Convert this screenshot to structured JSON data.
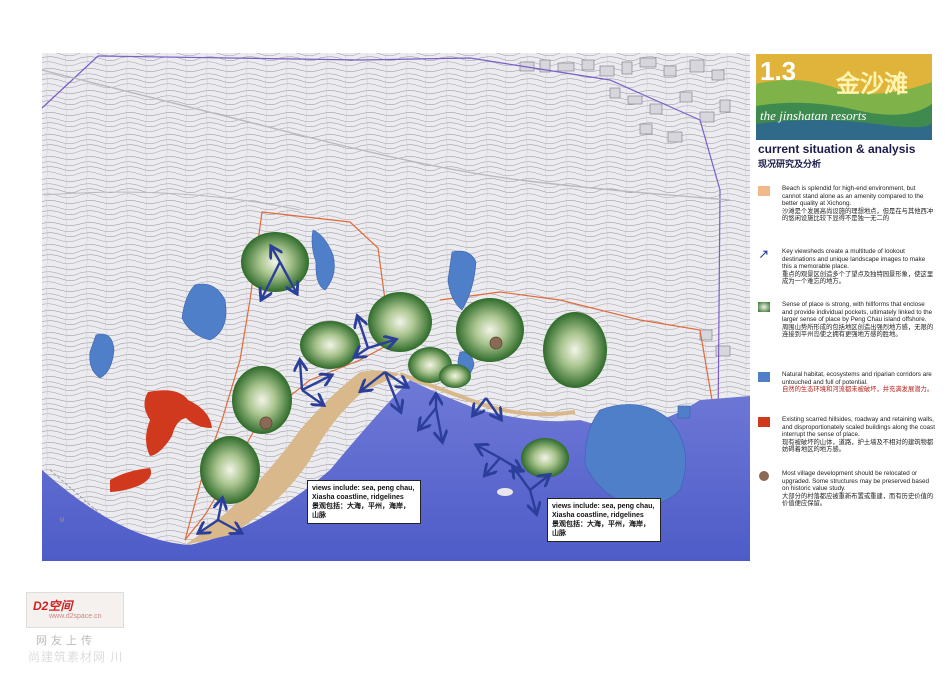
{
  "logo": {
    "number": "1.3",
    "chinese": "金沙滩",
    "english": "the jinshatan resorts"
  },
  "panel": {
    "title": "current situation & analysis",
    "subtitle": "现况研究及分析"
  },
  "legend": [
    {
      "symbol": "beach-swatch",
      "color": "#f1b98a",
      "en": "Beach is splendid for high-end environment, but cannot stand alone as an amenity compared to the better quality at Xichong.",
      "zh": "沙滩是个发展高尚设施的理想地点，但是在与其他西冲的悠闲设施比较下显得不是独一无二的"
    },
    {
      "symbol": "viewshed-arrow",
      "color": "#2b3e9a",
      "en": "Key viewsheds create a multitude of lookout destinations and unique landscape images to make this a memorable place.",
      "zh": "重点的观景区创造多个了望点及独特园景形象，使这里成为一个难忘的地方。"
    },
    {
      "symbol": "hillform-swatch",
      "color": "#2e6b2a",
      "en": "Sense of place is strong, with hillforms that enclose and provide individual pockets, ultimately linked to the larger sense of place by Peng Chau island offshore.",
      "zh": "周围山势所形成的包括地区创造出强烈地方感，无限的连接到平州岛使之拥有更强地方感的胜地。"
    },
    {
      "symbol": "habitat-swatch",
      "color": "#4f7fc8",
      "en": "Natural habitat, ecosystems and riparian corridors are untouched and full of potential.",
      "zh": "自然的生态环境和河流都未被破坏，并充满发展潜力。"
    },
    {
      "symbol": "scarred-swatch",
      "color": "#d0391e",
      "en": "Existing scarred hillsides, roadway and retaining walls, and disproportionately scaled buildings along the coast interrupt the sense of place.",
      "zh": "现有被破坏的山体，道路，护土墙及不相对的建筑物都妨碍着地区的地方感。"
    },
    {
      "symbol": "village-dot",
      "color": "#8a6a55",
      "en": "Most village development should be relocated or upgraded. Some structures may be preserved based on historic value study.",
      "zh": "大部分的村落都应被重新布置或重建，而有历史价值的价值便应保留。"
    }
  ],
  "map": {
    "callouts": [
      {
        "en": "views include: sea, peng chau, Xiasha coastline, ridgelines",
        "zh": "景观包括：大海，平州，海岸，山脉"
      },
      {
        "en": "views include: sea, peng chau, Xiasha coastline, ridgelines",
        "zh": "景观包括：大海，平州，海岸，山脉"
      }
    ]
  },
  "watermark": {
    "logo": "D2空间",
    "url": "www.d2space.cn",
    "line1": "网友上传",
    "line2": "尚建筑素材网 川"
  }
}
